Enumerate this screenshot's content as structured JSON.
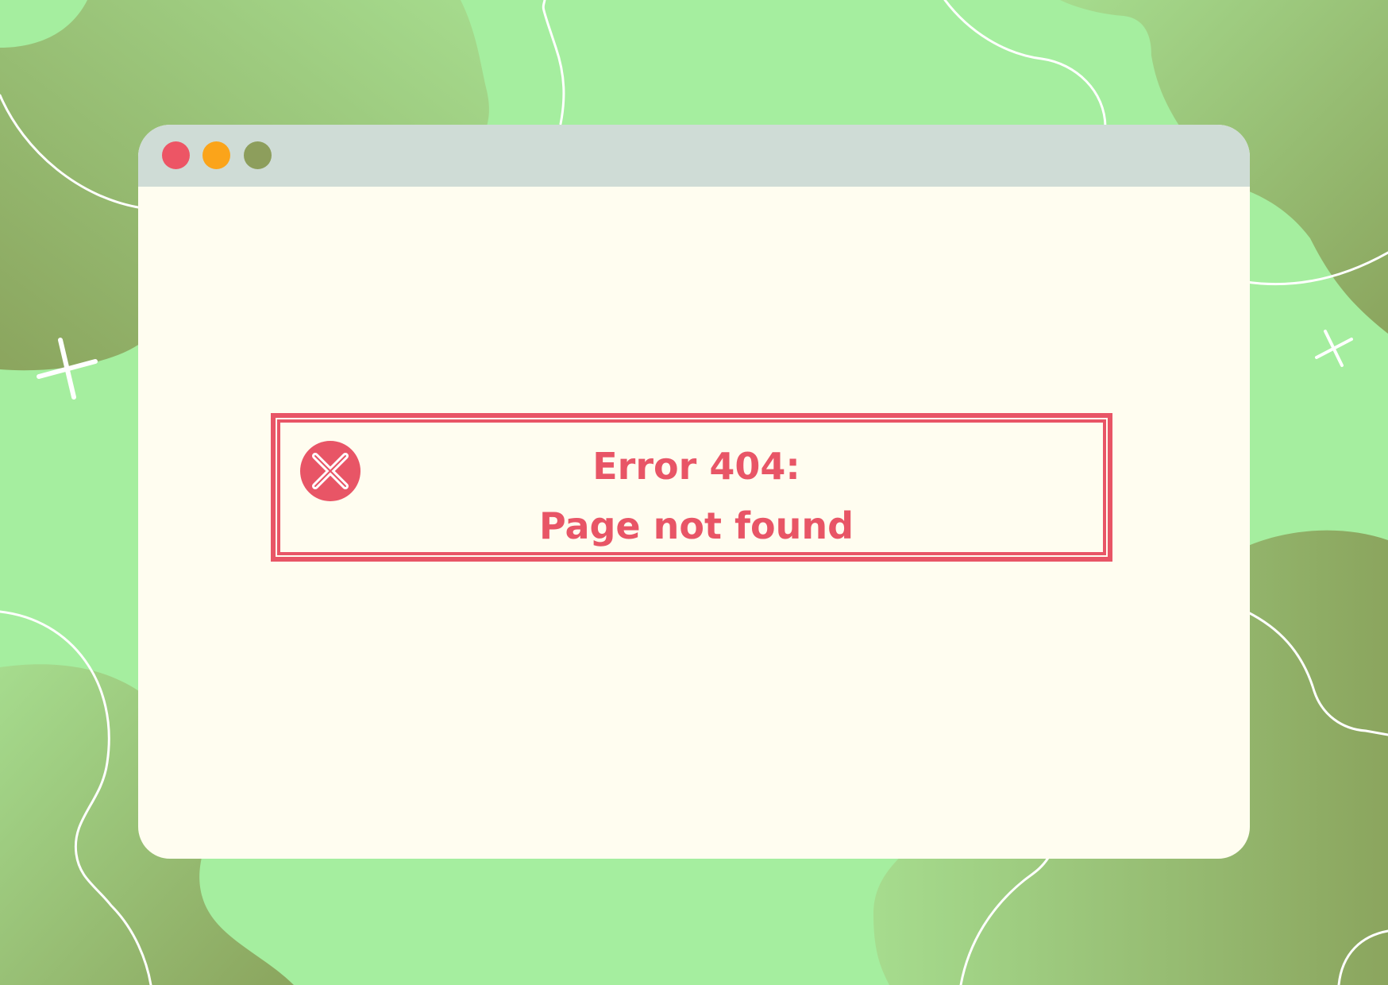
{
  "error": {
    "title": "Error 404:",
    "message": "Page not found"
  },
  "window_controls": [
    "close",
    "minimize",
    "maximize"
  ],
  "icons": {
    "error": "error-x-circle-icon",
    "sparkles": "sparkle-cross-icon"
  },
  "colors": {
    "background": "#a5ee9f",
    "blob_dark": "#8ba55e",
    "window_body": "#fffdf0",
    "title_bar": "#cfdcd6",
    "close_dot": "#ed5565",
    "minimize_dot": "#fba41a",
    "maximize_dot": "#8d9e5c",
    "error_accent": "#e85566"
  }
}
